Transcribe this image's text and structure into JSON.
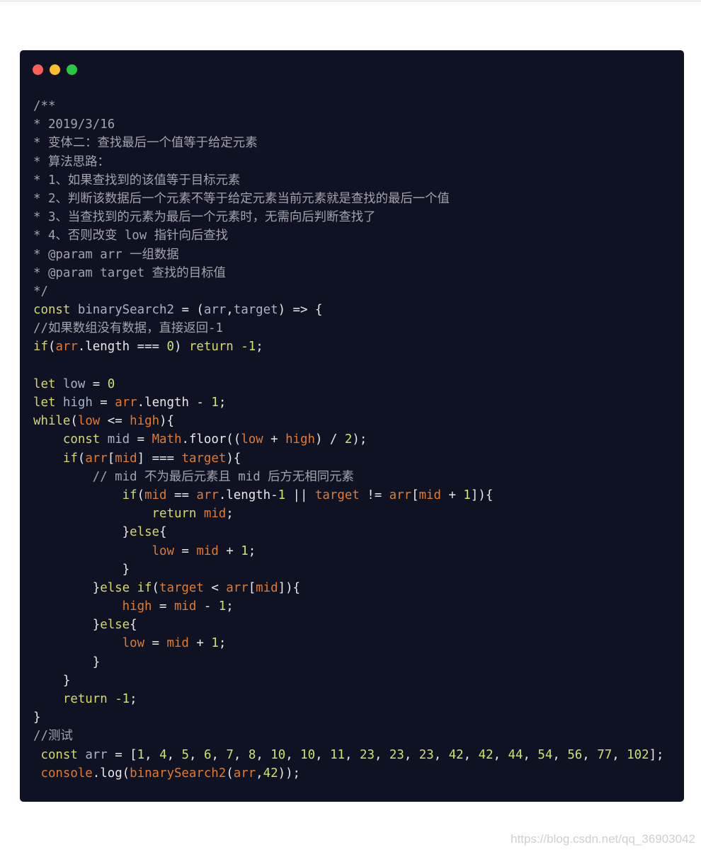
{
  "window": {
    "controls": [
      {
        "name": "close",
        "color": "#fc5f57"
      },
      {
        "name": "minimize",
        "color": "#fdbb2e"
      },
      {
        "name": "maximize",
        "color": "#29c840"
      }
    ]
  },
  "colors": {
    "background": "#0f1222",
    "keyword": "#d6d86c",
    "variable": "#e27a30",
    "comment": "#a2a3ad",
    "number": "#cfe26e"
  },
  "code_lines": [
    [
      [
        "c",
        "/**"
      ]
    ],
    [
      [
        "c",
        "* 2019/3/16"
      ]
    ],
    [
      [
        "c",
        "* 变体二：查找最后一个值等于给定元素"
      ]
    ],
    [
      [
        "c",
        "* 算法思路："
      ]
    ],
    [
      [
        "c",
        "* 1、如果查找到的该值等于目标元素"
      ]
    ],
    [
      [
        "c",
        "* 2、判断该数据后一个元素不等于给定元素当前元素就是查找的最后一个值"
      ]
    ],
    [
      [
        "c",
        "* 3、当查找到的元素为最后一个元素时，无需向后判断查找了"
      ]
    ],
    [
      [
        "c",
        "* 4、否则改变 low 指针向后查找"
      ]
    ],
    [
      [
        "c",
        "* @param arr 一组数据"
      ]
    ],
    [
      [
        "c",
        "* @param target 查找的目标值"
      ]
    ],
    [
      [
        "c",
        "*/"
      ]
    ],
    [
      [
        "k",
        "const"
      ],
      [
        "p",
        " "
      ],
      [
        "i",
        "binarySearch2"
      ],
      [
        "p",
        " = ("
      ],
      [
        "i",
        "arr"
      ],
      [
        "p",
        ","
      ],
      [
        "i",
        "target"
      ],
      [
        "p",
        ") => {"
      ]
    ],
    [
      [
        "c",
        "//如果数组没有数据，直接返回-1"
      ]
    ],
    [
      [
        "k",
        "if"
      ],
      [
        "p",
        "("
      ],
      [
        "v",
        "arr"
      ],
      [
        "p",
        ".length === "
      ],
      [
        "n",
        "0"
      ],
      [
        "p",
        ") "
      ],
      [
        "k",
        "return"
      ],
      [
        "p",
        " "
      ],
      [
        "n",
        "-1"
      ],
      [
        "p",
        ";"
      ]
    ],
    [],
    [
      [
        "k",
        "let"
      ],
      [
        "p",
        " "
      ],
      [
        "i",
        "low"
      ],
      [
        "p",
        " = "
      ],
      [
        "n",
        "0"
      ]
    ],
    [
      [
        "k",
        "let"
      ],
      [
        "p",
        " "
      ],
      [
        "i",
        "high"
      ],
      [
        "p",
        " = "
      ],
      [
        "v",
        "arr"
      ],
      [
        "p",
        ".length - "
      ],
      [
        "n",
        "1"
      ],
      [
        "p",
        ";"
      ]
    ],
    [
      [
        "k",
        "while"
      ],
      [
        "p",
        "("
      ],
      [
        "v",
        "low"
      ],
      [
        "p",
        " <= "
      ],
      [
        "v",
        "high"
      ],
      [
        "p",
        "){"
      ]
    ],
    [
      [
        "p",
        "    "
      ],
      [
        "k",
        "const"
      ],
      [
        "p",
        " "
      ],
      [
        "i",
        "mid"
      ],
      [
        "p",
        " = "
      ],
      [
        "v",
        "Math"
      ],
      [
        "p",
        ".floor(("
      ],
      [
        "v",
        "low"
      ],
      [
        "p",
        " + "
      ],
      [
        "v",
        "high"
      ],
      [
        "p",
        ") / "
      ],
      [
        "n",
        "2"
      ],
      [
        "p",
        ");"
      ]
    ],
    [
      [
        "p",
        "    "
      ],
      [
        "k",
        "if"
      ],
      [
        "p",
        "("
      ],
      [
        "v",
        "arr"
      ],
      [
        "p",
        "["
      ],
      [
        "v",
        "mid"
      ],
      [
        "p",
        "] === "
      ],
      [
        "v",
        "target"
      ],
      [
        "p",
        "){"
      ]
    ],
    [
      [
        "c",
        "        // mid 不为最后元素且 mid 后方无相同元素"
      ]
    ],
    [
      [
        "p",
        "            "
      ],
      [
        "k",
        "if"
      ],
      [
        "p",
        "("
      ],
      [
        "v",
        "mid"
      ],
      [
        "p",
        " == "
      ],
      [
        "v",
        "arr"
      ],
      [
        "p",
        ".length-"
      ],
      [
        "n",
        "1"
      ],
      [
        "p",
        " || "
      ],
      [
        "v",
        "target"
      ],
      [
        "p",
        " != "
      ],
      [
        "v",
        "arr"
      ],
      [
        "p",
        "["
      ],
      [
        "v",
        "mid"
      ],
      [
        "p",
        " + "
      ],
      [
        "n",
        "1"
      ],
      [
        "p",
        "]){"
      ]
    ],
    [
      [
        "p",
        "                "
      ],
      [
        "k",
        "return"
      ],
      [
        "p",
        " "
      ],
      [
        "v",
        "mid"
      ],
      [
        "p",
        ";"
      ]
    ],
    [
      [
        "p",
        "            }"
      ],
      [
        "k",
        "else"
      ],
      [
        "p",
        "{"
      ]
    ],
    [
      [
        "p",
        "                "
      ],
      [
        "v",
        "low"
      ],
      [
        "p",
        " = "
      ],
      [
        "v",
        "mid"
      ],
      [
        "p",
        " + "
      ],
      [
        "n",
        "1"
      ],
      [
        "p",
        ";"
      ]
    ],
    [
      [
        "p",
        "            }"
      ]
    ],
    [
      [
        "p",
        "        }"
      ],
      [
        "k",
        "else if"
      ],
      [
        "p",
        "("
      ],
      [
        "v",
        "target"
      ],
      [
        "p",
        " < "
      ],
      [
        "v",
        "arr"
      ],
      [
        "p",
        "["
      ],
      [
        "v",
        "mid"
      ],
      [
        "p",
        "]){"
      ]
    ],
    [
      [
        "p",
        "            "
      ],
      [
        "v",
        "high"
      ],
      [
        "p",
        " = "
      ],
      [
        "v",
        "mid"
      ],
      [
        "p",
        " - "
      ],
      [
        "n",
        "1"
      ],
      [
        "p",
        ";"
      ]
    ],
    [
      [
        "p",
        "        }"
      ],
      [
        "k",
        "else"
      ],
      [
        "p",
        "{"
      ]
    ],
    [
      [
        "p",
        "            "
      ],
      [
        "v",
        "low"
      ],
      [
        "p",
        " = "
      ],
      [
        "v",
        "mid"
      ],
      [
        "p",
        " + "
      ],
      [
        "n",
        "1"
      ],
      [
        "p",
        ";"
      ]
    ],
    [
      [
        "p",
        "        }"
      ]
    ],
    [
      [
        "p",
        "    }"
      ]
    ],
    [
      [
        "p",
        "    "
      ],
      [
        "k",
        "return"
      ],
      [
        "p",
        " "
      ],
      [
        "n",
        "-1"
      ],
      [
        "p",
        ";"
      ]
    ],
    [
      [
        "p",
        "}"
      ]
    ],
    [
      [
        "c",
        "//测试"
      ]
    ],
    [
      [
        "p",
        " "
      ],
      [
        "k",
        "const"
      ],
      [
        "p",
        " "
      ],
      [
        "i",
        "arr"
      ],
      [
        "p",
        " = ["
      ],
      [
        "n",
        "1"
      ],
      [
        "p",
        ", "
      ],
      [
        "n",
        "4"
      ],
      [
        "p",
        ", "
      ],
      [
        "n",
        "5"
      ],
      [
        "p",
        ", "
      ],
      [
        "n",
        "6"
      ],
      [
        "p",
        ", "
      ],
      [
        "n",
        "7"
      ],
      [
        "p",
        ", "
      ],
      [
        "n",
        "8"
      ],
      [
        "p",
        ", "
      ],
      [
        "n",
        "10"
      ],
      [
        "p",
        ", "
      ],
      [
        "n",
        "10"
      ],
      [
        "p",
        ", "
      ],
      [
        "n",
        "11"
      ],
      [
        "p",
        ", "
      ],
      [
        "n",
        "23"
      ],
      [
        "p",
        ", "
      ],
      [
        "n",
        "23"
      ],
      [
        "p",
        ", "
      ],
      [
        "n",
        "23"
      ],
      [
        "p",
        ", "
      ],
      [
        "n",
        "42"
      ],
      [
        "p",
        ", "
      ],
      [
        "n",
        "42"
      ],
      [
        "p",
        ", "
      ],
      [
        "n",
        "44"
      ],
      [
        "p",
        ", "
      ],
      [
        "n",
        "54"
      ],
      [
        "p",
        ", "
      ],
      [
        "n",
        "56"
      ],
      [
        "p",
        ", "
      ],
      [
        "n",
        "77"
      ],
      [
        "p",
        ", "
      ],
      [
        "n",
        "102"
      ],
      [
        "p",
        "];"
      ]
    ],
    [
      [
        "p",
        " "
      ],
      [
        "v",
        "console"
      ],
      [
        "p",
        ".log("
      ],
      [
        "v",
        "binarySearch2"
      ],
      [
        "p",
        "("
      ],
      [
        "v",
        "arr"
      ],
      [
        "p",
        ","
      ],
      [
        "n",
        "42"
      ],
      [
        "p",
        "));"
      ]
    ]
  ],
  "watermark": "https://blog.csdn.net/qq_36903042"
}
